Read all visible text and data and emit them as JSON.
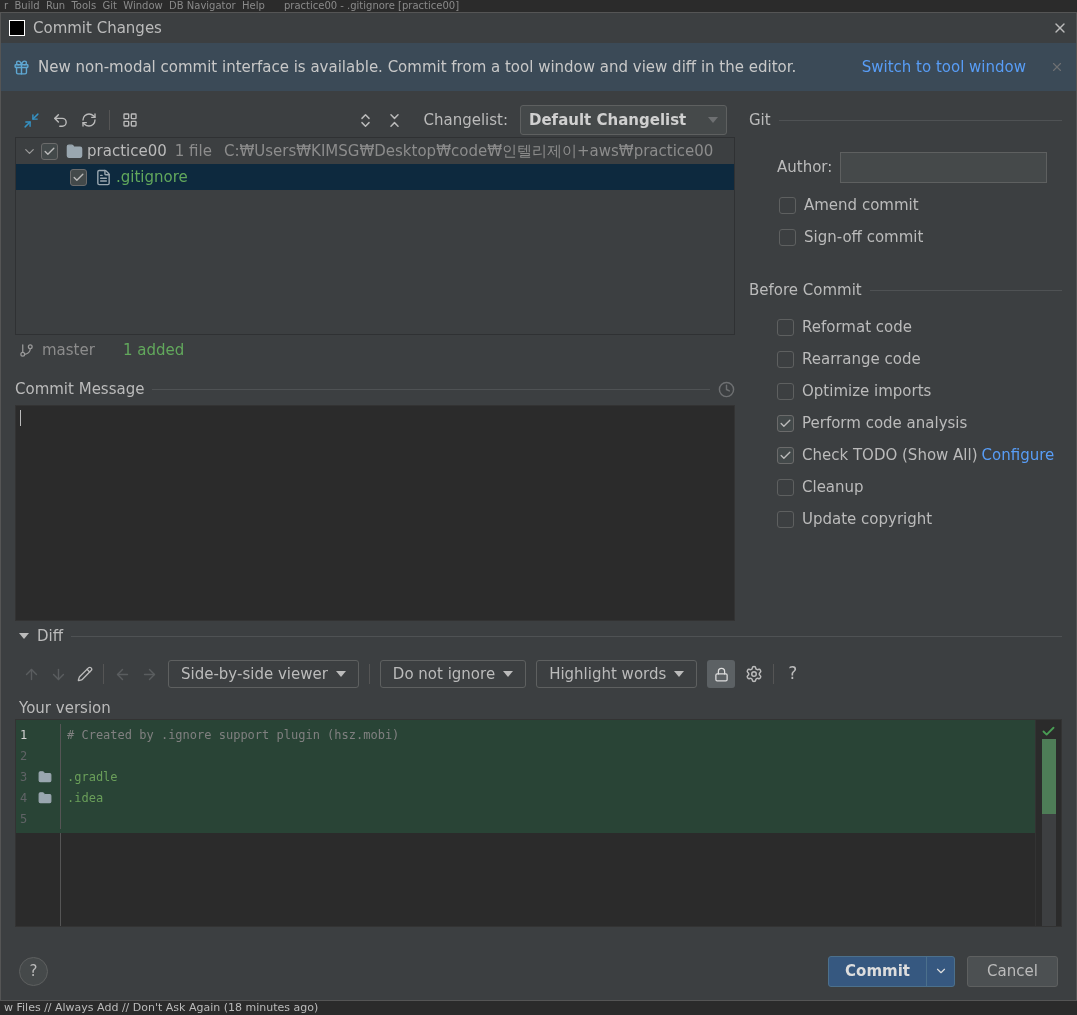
{
  "background_menu": "r  Build  Run  Tools  Git  Window  DB Navigator  Help      practice00 - .gitignore [practice00]",
  "window": {
    "title": "Commit Changes"
  },
  "banner": {
    "text": "New non-modal commit interface is available. Commit from a tool window and view diff in the editor.",
    "link": "Switch to tool window"
  },
  "changes": {
    "changelist_label": "Changelist:",
    "changelist": "Default Changelist",
    "tree": [
      {
        "name": "practice00",
        "checked": true,
        "expanded": true,
        "selected": false,
        "info": "1 file",
        "path": "C:₩Users₩KIMSG₩Desktop₩code₩인텔리제이+aws₩practice00",
        "children": [
          {
            "name": ".gitignore",
            "checked": true,
            "selected": true
          }
        ]
      }
    ],
    "branch": "master",
    "summary": "1 added"
  },
  "commit_message": {
    "label": "Commit Message"
  },
  "git": {
    "title": "Git",
    "author_label": "Author:",
    "options": [
      {
        "label": "Amend commit",
        "checked": false
      },
      {
        "label": "Sign-off commit",
        "checked": false
      }
    ]
  },
  "before_commit": {
    "title": "Before Commit",
    "options": [
      {
        "label": "Reformat code",
        "checked": false
      },
      {
        "label": "Rearrange code",
        "checked": false
      },
      {
        "label": "Optimize imports",
        "checked": false
      },
      {
        "label": "Perform code analysis",
        "checked": true
      },
      {
        "label": "Check TODO (Show All)",
        "checked": true,
        "link": "Configure"
      },
      {
        "label": "Cleanup",
        "checked": false
      },
      {
        "label": "Update copyright",
        "checked": false
      }
    ]
  },
  "diff": {
    "title": "Diff",
    "expanded": true,
    "viewer": "Side-by-side viewer",
    "ignore": "Do not ignore",
    "highlight": "Highlight words",
    "help": "?",
    "version_label": "Your version",
    "lines": [
      {
        "number": "1",
        "kind": "comment",
        "text": "# Created by .ignore support plugin (hsz.mobi)"
      },
      {
        "number": "2",
        "kind": "blank"
      },
      {
        "number": "3",
        "kind": "folder",
        "text": ".gradle"
      },
      {
        "number": "4",
        "kind": "folder",
        "text": ".idea"
      },
      {
        "number": "5",
        "kind": "blank"
      }
    ]
  },
  "footer": {
    "help": "?",
    "commit": "Commit",
    "cancel": "Cancel"
  },
  "background_status": "w Files // Always Add // Don't Ask Again (18 minutes ago)"
}
